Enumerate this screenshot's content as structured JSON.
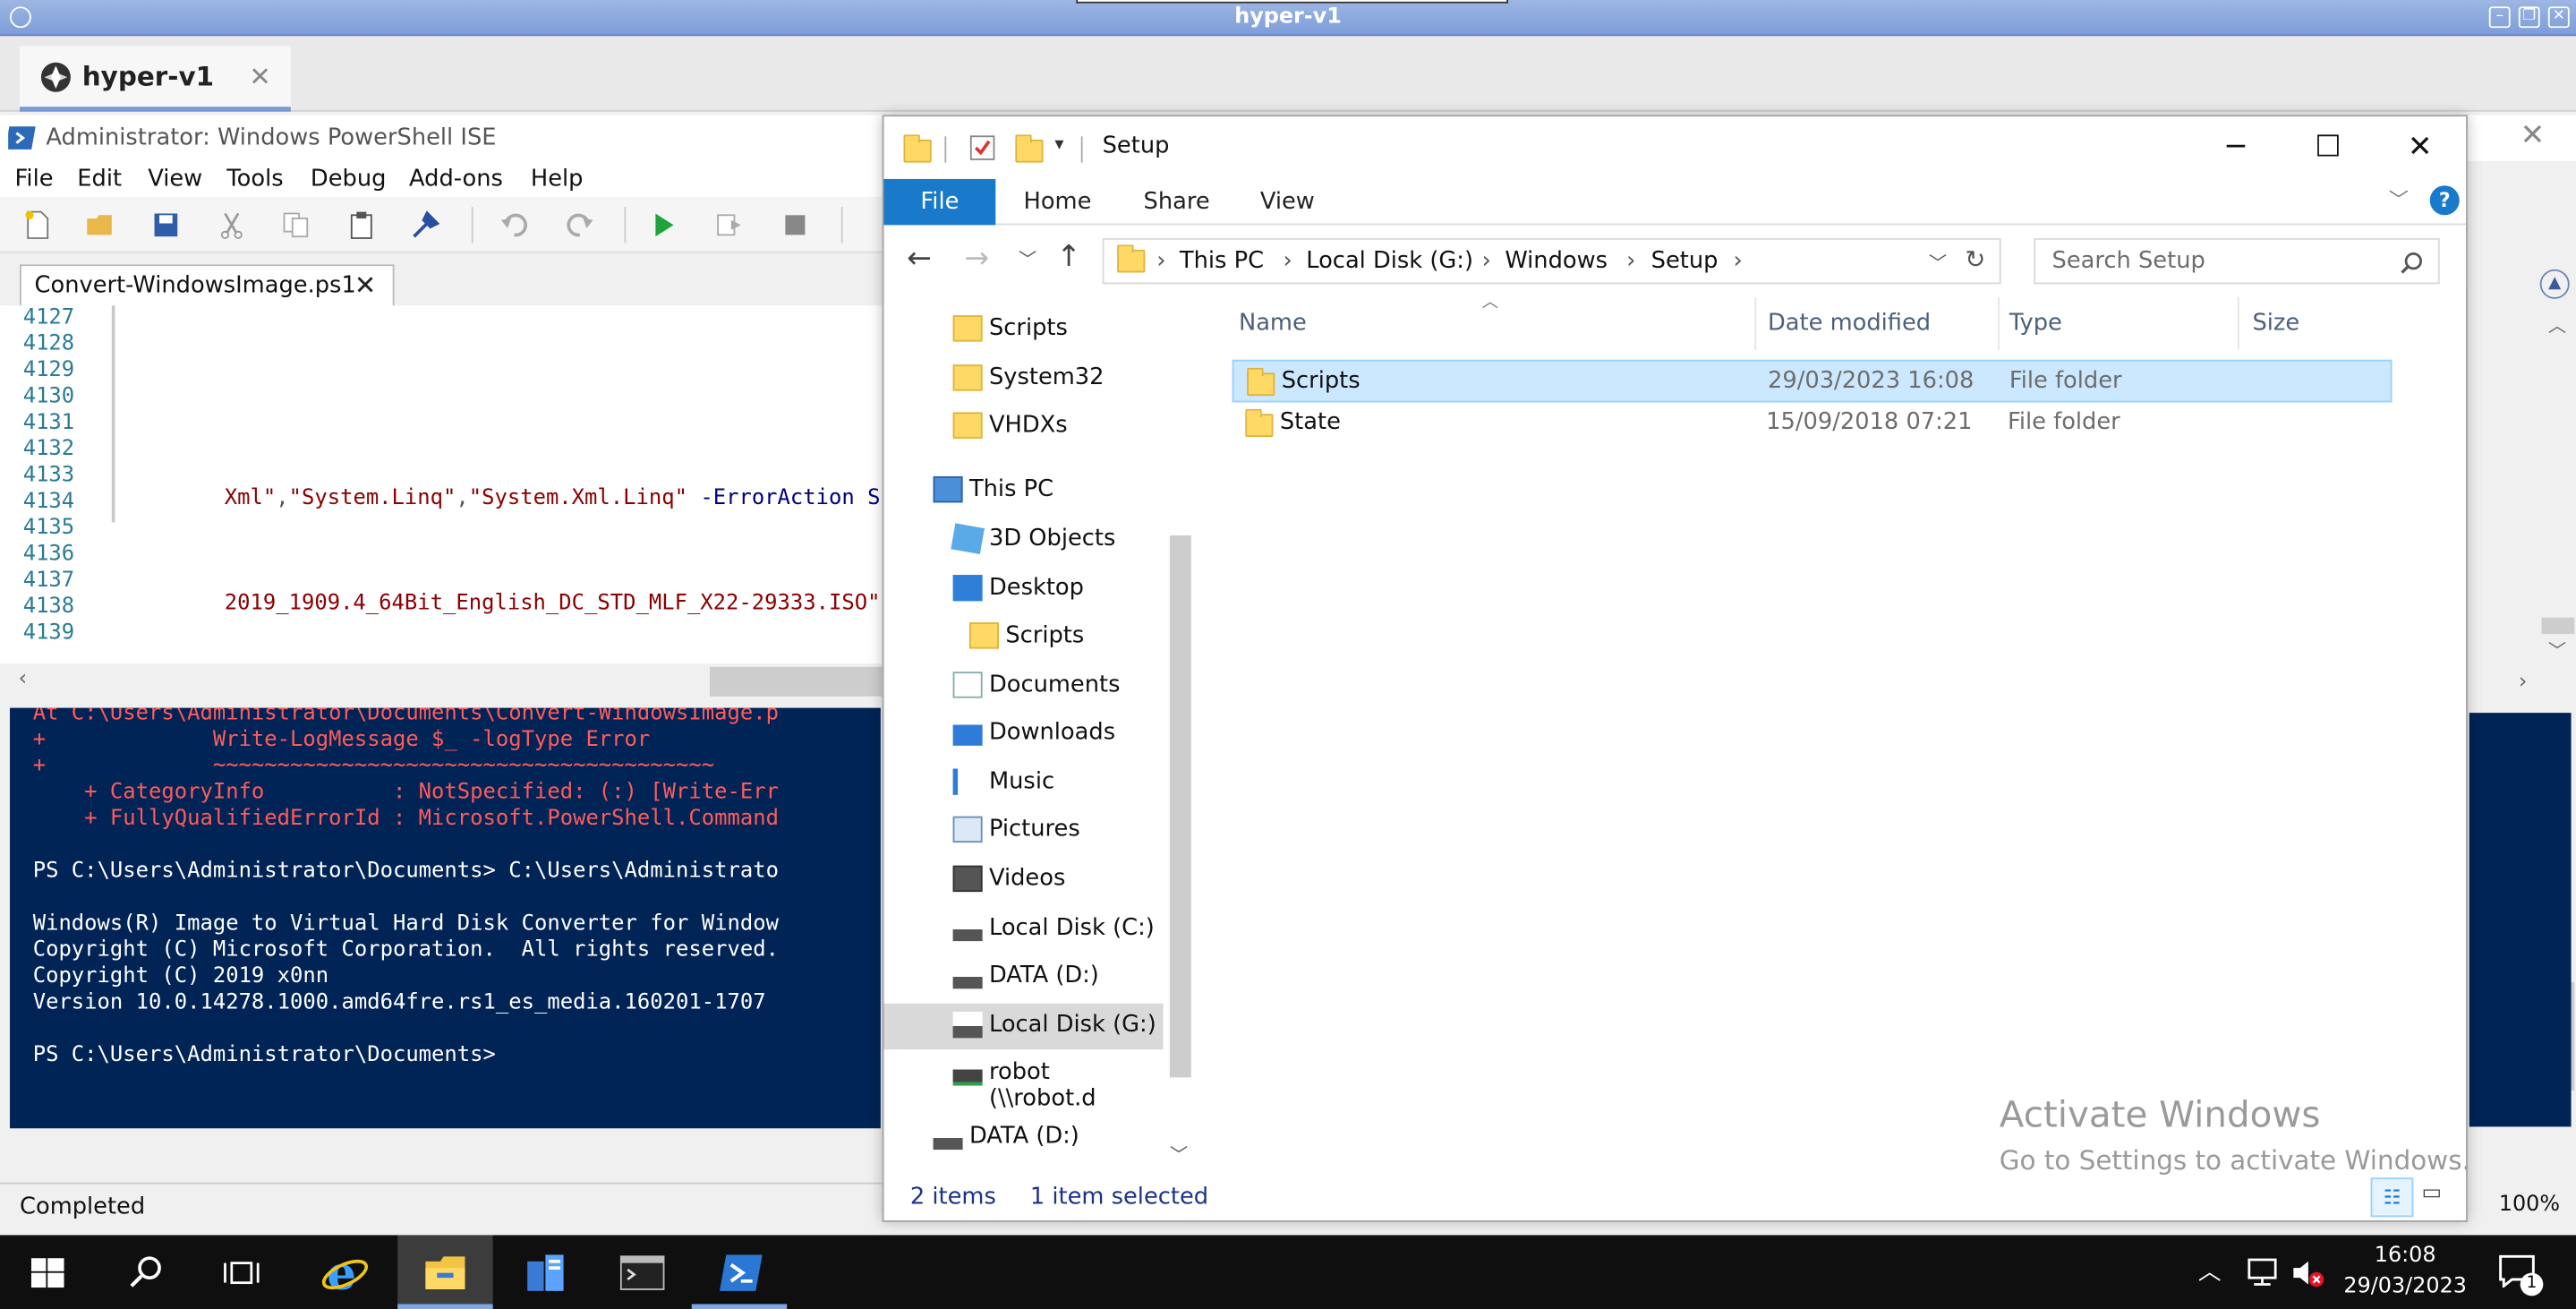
{
  "host": {
    "window_title": "hyper-v1",
    "tab_label": "hyper-v1",
    "tab_close": "✕"
  },
  "ise": {
    "title": "Administrator: Windows PowerShell ISE",
    "menu": [
      "File",
      "Edit",
      "View",
      "Tools",
      "Debug",
      "Add-ons",
      "Help"
    ],
    "script_tab": "Convert-WindowsImage.ps1",
    "script_tab_close": "✕",
    "line_numbers": [
      "4127",
      "4128",
      "4129",
      "4130",
      "4131",
      "4132",
      "4133",
      "4134",
      "4135",
      "4136",
      "4137",
      "4138",
      "4139"
    ],
    "code_line_4133": {
      "s1": "Xml\"",
      "c1": ",",
      "s2": "\"System.Linq\"",
      "c2": ",",
      "s3": "\"System.Xml.Linq\"",
      "param": " -ErrorAction ",
      "rest": "Sil"
    },
    "code_line_4137": {
      "s1": "2019_1909.4_64Bit_English_DC_STD_MLF_X22-29333.ISO\"",
      "rest": " -"
    },
    "console_lines": [
      {
        "text": "At C:\\Users\\Administrator\\Documents\\Convert-WindowsImage.p",
        "kind": "err"
      },
      {
        "text": "+             Write-LogMessage $_ -logType Error",
        "kind": "err"
      },
      {
        "text": "+             ~~~~~~~~~~~~~~~~~~~~~~~~~~~~~~~~~~~~~~~",
        "kind": "err"
      },
      {
        "text": "    + CategoryInfo          : NotSpecified: (:) [Write-Err",
        "kind": "err"
      },
      {
        "text": "    + FullyQualifiedErrorId : Microsoft.PowerShell.Command",
        "kind": "err"
      },
      {
        "text": "",
        "kind": "out"
      },
      {
        "text": "PS C:\\Users\\Administrator\\Documents> C:\\Users\\Administrato",
        "kind": "out"
      },
      {
        "text": "",
        "kind": "out"
      },
      {
        "text": "Windows(R) Image to Virtual Hard Disk Converter for Window",
        "kind": "out"
      },
      {
        "text": "Copyright (C) Microsoft Corporation.  All rights reserved.",
        "kind": "out"
      },
      {
        "text": "Copyright (C) 2019 x0nn",
        "kind": "out"
      },
      {
        "text": "Version 10.0.14278.1000.amd64fre.rs1_es_media.160201-1707",
        "kind": "out"
      },
      {
        "text": "",
        "kind": "out"
      },
      {
        "text": "PS C:\\Users\\Administrator\\Documents>",
        "kind": "out"
      }
    ],
    "status": "Completed",
    "zoom": "100%"
  },
  "explorer": {
    "title": "Setup",
    "ribbon": {
      "file": "File",
      "home": "Home",
      "share": "Share",
      "view": "View"
    },
    "breadcrumb": [
      "This PC",
      "Local Disk (G:)",
      "Windows",
      "Setup"
    ],
    "search_placeholder": "Search Setup",
    "nav": [
      {
        "label": "Scripts",
        "icon": "folder-icon",
        "indent": 1
      },
      {
        "label": "System32",
        "icon": "folder-icon",
        "indent": 1
      },
      {
        "label": "VHDXs",
        "icon": "folder-icon",
        "indent": 1
      },
      {
        "label": "This PC",
        "icon": "computer-icon",
        "indent": 0
      },
      {
        "label": "3D Objects",
        "icon": "cube-icon",
        "indent": 1
      },
      {
        "label": "Desktop",
        "icon": "desktop-icon",
        "indent": 1
      },
      {
        "label": "Scripts",
        "icon": "folder-icon",
        "indent": 2
      },
      {
        "label": "Documents",
        "icon": "document-icon",
        "indent": 1
      },
      {
        "label": "Downloads",
        "icon": "download-icon",
        "indent": 1
      },
      {
        "label": "Music",
        "icon": "music-icon",
        "indent": 1
      },
      {
        "label": "Pictures",
        "icon": "pictures-icon",
        "indent": 1
      },
      {
        "label": "Videos",
        "icon": "video-icon",
        "indent": 1
      },
      {
        "label": "Local Disk (C:)",
        "icon": "drive-icon",
        "indent": 1
      },
      {
        "label": "DATA (D:)",
        "icon": "drive-icon",
        "indent": 1
      },
      {
        "label": "Local Disk (G:)",
        "icon": "drive-icon",
        "indent": 1,
        "selected": true
      },
      {
        "label": "robot (\\\\robot.d",
        "icon": "network-drive-icon",
        "indent": 1
      },
      {
        "label": "DATA (D:)",
        "icon": "drive-icon",
        "indent": 0
      }
    ],
    "columns": {
      "name": "Name",
      "date": "Date modified",
      "type": "Type",
      "size": "Size"
    },
    "files": [
      {
        "name": "Scripts",
        "date": "29/03/2023 16:08",
        "type": "File folder",
        "selected": true
      },
      {
        "name": "State",
        "date": "15/09/2018 07:21",
        "type": "File folder",
        "selected": false
      }
    ],
    "status_items": "2 items",
    "status_selected": "1 item selected",
    "watermark_title": "Activate Windows",
    "watermark_sub": "Go to Settings to activate Windows."
  },
  "taskbar": {
    "time": "16:08",
    "date": "29/03/2023",
    "notification_count": "1"
  },
  "colors": {
    "accent": "#1979ca",
    "console_bg": "#012456",
    "selection": "#cce8ff"
  }
}
